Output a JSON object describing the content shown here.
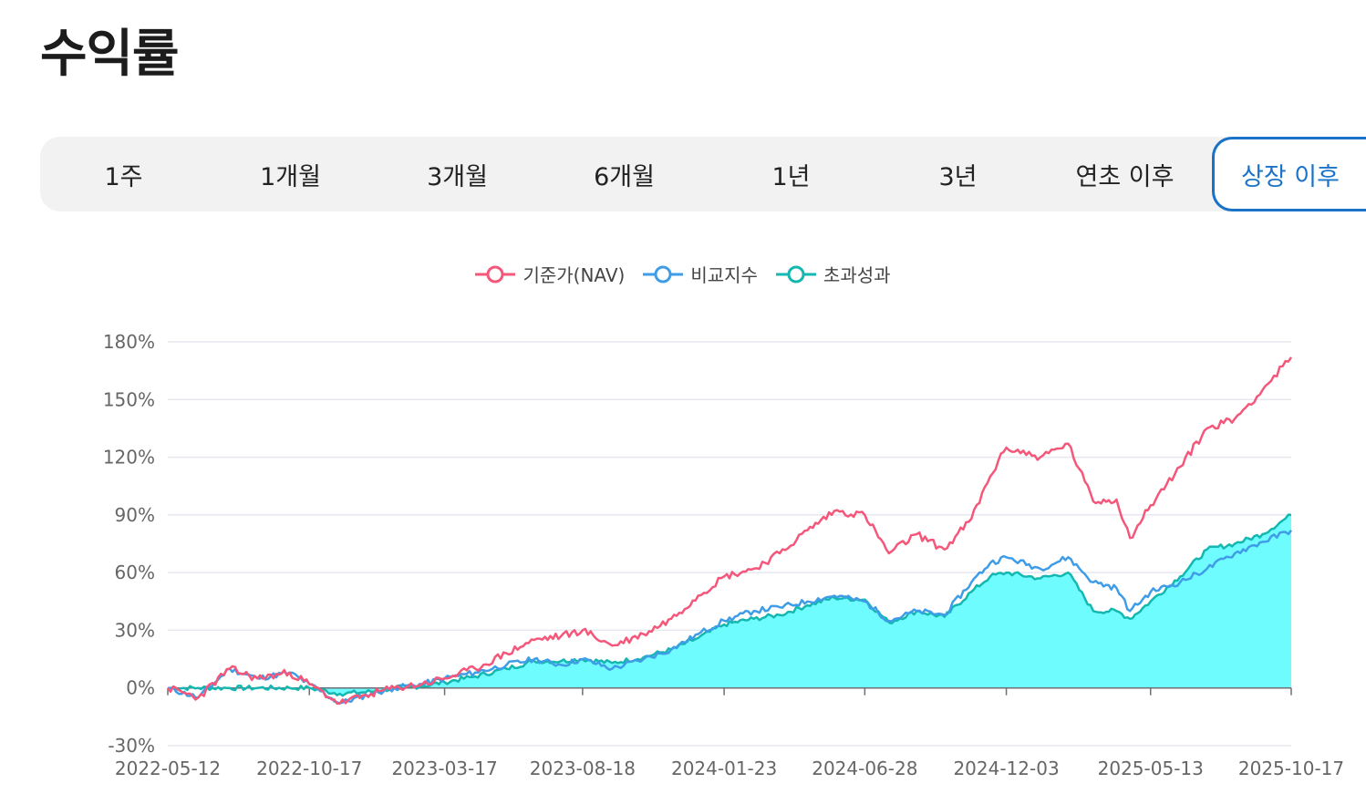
{
  "page": {
    "title": "수익률"
  },
  "tabs": [
    {
      "label": "1주",
      "active": false
    },
    {
      "label": "1개월",
      "active": false
    },
    {
      "label": "3개월",
      "active": false
    },
    {
      "label": "6개월",
      "active": false
    },
    {
      "label": "1년",
      "active": false
    },
    {
      "label": "3년",
      "active": false
    },
    {
      "label": "연초 이후",
      "active": false
    },
    {
      "label": "상장 이후",
      "active": true
    }
  ],
  "colors": {
    "nav": "#f4577a",
    "benchmark": "#3f9de8",
    "excess": "#14b8b0",
    "excess_fill": "#6ffcff",
    "active_tab": "#1a73c8"
  },
  "chart_data": {
    "type": "line",
    "title": "",
    "xlabel": "",
    "ylabel": "",
    "x_ticks": [
      "2022-05-12",
      "2022-10-17",
      "2023-03-17",
      "2023-08-18",
      "2024-01-23",
      "2024-06-28",
      "2024-12-03",
      "2025-05-13",
      "2025-10-17"
    ],
    "y_ticks": [
      "180%",
      "150%",
      "120%",
      "90%",
      "60%",
      "30%",
      "0%",
      "-30%"
    ],
    "ylim": [
      -30,
      180
    ],
    "xlim": [
      "2022-05-12",
      "2025-10-17"
    ],
    "grid": true,
    "legend_position": "top-center",
    "x": [
      "2022-05-12",
      "2022-06-15",
      "2022-07-20",
      "2022-08-20",
      "2022-09-25",
      "2022-10-17",
      "2022-11-20",
      "2022-12-25",
      "2023-01-20",
      "2023-02-20",
      "2023-03-17",
      "2023-04-20",
      "2023-05-25",
      "2023-06-25",
      "2023-07-25",
      "2023-08-18",
      "2023-09-20",
      "2023-10-25",
      "2023-11-25",
      "2023-12-25",
      "2024-01-23",
      "2024-02-25",
      "2024-03-25",
      "2024-04-25",
      "2024-05-25",
      "2024-06-28",
      "2024-07-25",
      "2024-08-25",
      "2024-09-25",
      "2024-10-25",
      "2024-11-15",
      "2024-12-03",
      "2025-01-10",
      "2025-02-10",
      "2025-03-10",
      "2025-04-05",
      "2025-04-20",
      "2025-05-13",
      "2025-06-15",
      "2025-07-15",
      "2025-08-15",
      "2025-09-15",
      "2025-10-17"
    ],
    "series": [
      {
        "name": "기준가(NAV)",
        "values": [
          0,
          -5,
          10,
          5,
          8,
          2,
          -8,
          -3,
          0,
          2,
          5,
          10,
          18,
          25,
          27,
          30,
          22,
          28,
          36,
          48,
          58,
          62,
          70,
          82,
          92,
          90,
          70,
          80,
          72,
          88,
          110,
          125,
          120,
          127,
          97,
          98,
          78,
          95,
          115,
          135,
          140,
          155,
          172
        ]
      },
      {
        "name": "비교지수",
        "values": [
          0,
          -5,
          10,
          5,
          8,
          2,
          -8,
          -3,
          0,
          2,
          5,
          8,
          12,
          15,
          12,
          15,
          10,
          15,
          20,
          28,
          35,
          40,
          42,
          45,
          48,
          45,
          35,
          40,
          38,
          55,
          65,
          68,
          62,
          68,
          55,
          52,
          40,
          50,
          55,
          62,
          70,
          76,
          82
        ]
      },
      {
        "name": "초과성과",
        "values": [
          0,
          0,
          0,
          0,
          0,
          0,
          -3,
          -2,
          0,
          1,
          3,
          6,
          10,
          14,
          14,
          15,
          13,
          16,
          20,
          26,
          33,
          36,
          38,
          43,
          47,
          46,
          34,
          40,
          37,
          50,
          58,
          60,
          57,
          60,
          40,
          40,
          36,
          45,
          58,
          72,
          75,
          80,
          90
        ]
      }
    ]
  }
}
